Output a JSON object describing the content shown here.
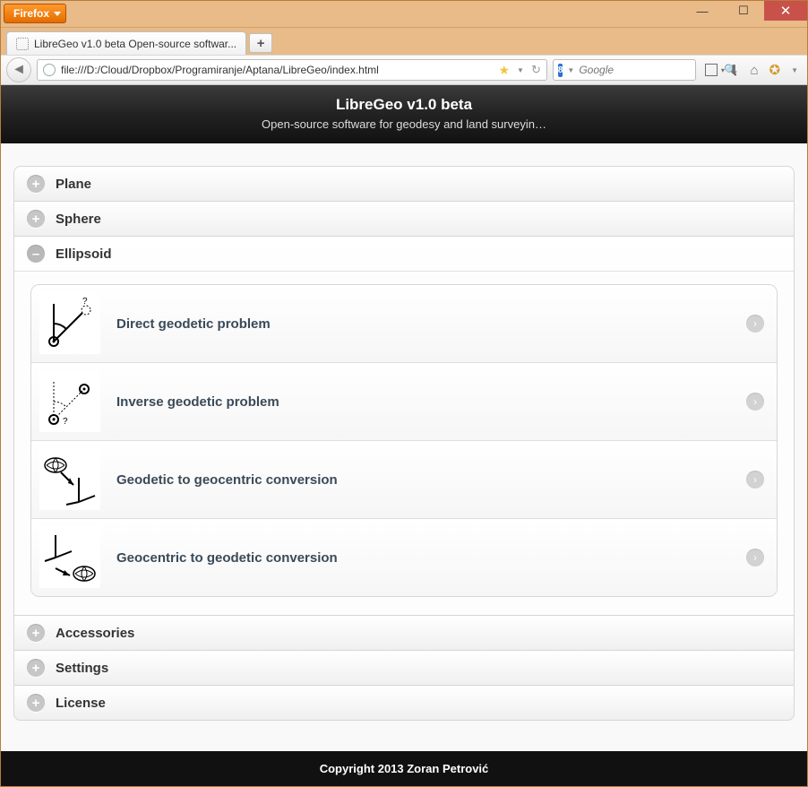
{
  "browser": {
    "name": "Firefox",
    "tab_title": "LibreGeo v1.0 beta Open-source softwar...",
    "url": "file:///D:/Cloud/Dropbox/Programiranje/Aptana/LibreGeo/index.html",
    "search_placeholder": "Google"
  },
  "header": {
    "title": "LibreGeo v1.0 beta",
    "subtitle": "Open-source software for geodesy and land surveyin…"
  },
  "accordion": {
    "plane": "Plane",
    "sphere": "Sphere",
    "ellipsoid": "Ellipsoid",
    "accessories": "Accessories",
    "settings": "Settings",
    "license": "License"
  },
  "ellipsoid_items": [
    {
      "label": "Direct geodetic problem"
    },
    {
      "label": "Inverse geodetic problem"
    },
    {
      "label": "Geodetic to geocentric conversion"
    },
    {
      "label": "Geocentric to geodetic conversion"
    }
  ],
  "footer": "Copyright 2013 Zoran Petrović"
}
